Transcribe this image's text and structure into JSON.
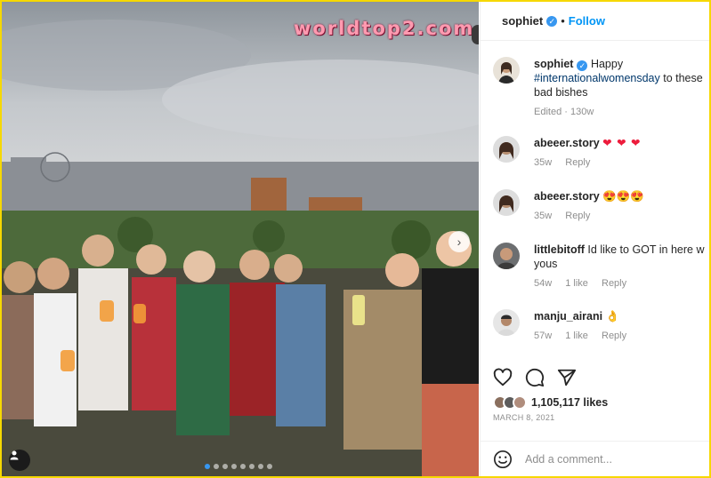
{
  "watermark": "worldtop2.com",
  "post": {
    "username": "sophiet",
    "follow_label": "Follow",
    "follow_separator": "•",
    "caption": {
      "username": "sophiet",
      "prefix": "Happy ",
      "hashtag": "#internationalwomensday",
      "suffix": " to these bad bishes",
      "meta": "Edited · 130w"
    },
    "comments": [
      {
        "username": "abeeer.story",
        "text": "❤ ❤ ❤",
        "age": "35w",
        "reply_label": "Reply",
        "type": "hearts"
      },
      {
        "username": "abeeer.story",
        "text": "😍😍😍",
        "age": "35w",
        "reply_label": "Reply",
        "type": "emoji"
      },
      {
        "username": "littlebitoff",
        "text": "Id like to GOT in here w yous",
        "age": "54w",
        "likes": "1 like",
        "reply_label": "Reply",
        "type": "text"
      },
      {
        "username": "manju_airani",
        "text": "👌",
        "age": "57w",
        "likes": "1 like",
        "reply_label": "Reply",
        "type": "emoji"
      }
    ],
    "likes": "1,105,117 likes",
    "date": "MARCH 8, 2021",
    "add_comment_placeholder": "Add a comment...",
    "carousel": {
      "total": 8,
      "active_index": 0
    }
  },
  "icons": {
    "like": "heart-icon",
    "comment": "comment-icon",
    "share": "paper-plane-icon",
    "emoji": "smiley-icon",
    "next": "chevron-right-icon",
    "tag": "person-icon",
    "verified": "verified-badge-icon"
  },
  "colors": {
    "accent": "#0095f6",
    "verified": "#3797f0",
    "heart": "#ed1c3c",
    "frame": "#f6d800"
  }
}
